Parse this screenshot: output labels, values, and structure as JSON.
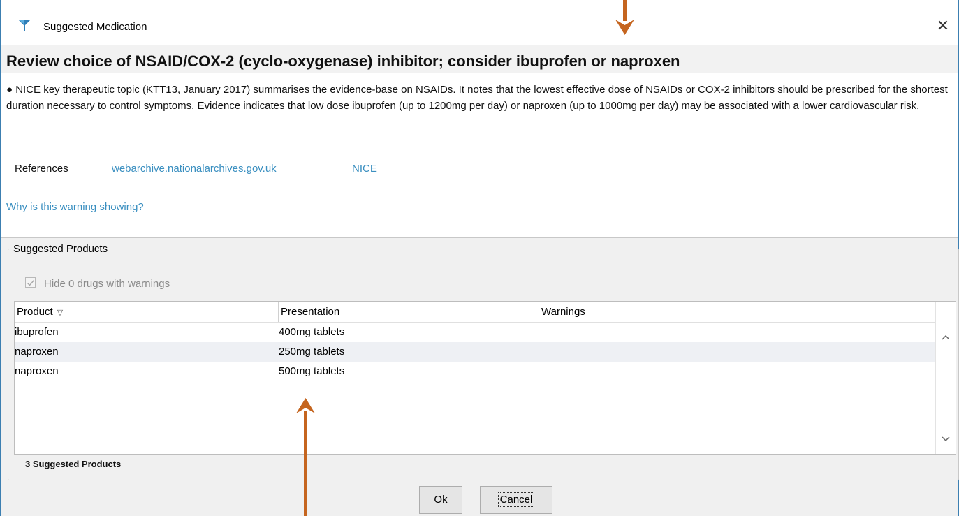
{
  "window": {
    "title": "Suggested Medication",
    "close_glyph": "✕",
    "icon": "funnel-app-icon"
  },
  "alert": {
    "heading": "Review choice of NSAID/COX-2 (cyclo-oxygenase) inhibitor; consider ibuprofen or naproxen",
    "body": "● NICE key therapeutic topic (KTT13, January 2017) summarises the evidence-base on NSAIDs. It notes that the lowest effective dose of NSAIDs or COX-2 inhibitors should be prescribed for the shortest duration necessary to control symptoms. Evidence indicates that low dose ibuprofen (up to 1200mg per day) or naproxen (up to 1000mg per day) may be associated with a lower cardiovascular risk.",
    "references_label": "References",
    "references": [
      "webarchive.nationalarchives.gov.uk",
      "NICE"
    ],
    "why_link": "Why is this warning showing?"
  },
  "suggested": {
    "group_label": "Suggested Products",
    "hide_checkbox_label": "Hide 0 drugs with warnings",
    "hide_checked": true,
    "columns": [
      "Product",
      "Presentation",
      "Warnings"
    ],
    "sort_icon": "▽",
    "rows": [
      {
        "product": "ibuprofen",
        "presentation": "400mg tablets",
        "warnings": ""
      },
      {
        "product": "naproxen",
        "presentation": "250mg tablets",
        "warnings": ""
      },
      {
        "product": "naproxen",
        "presentation": "500mg tablets",
        "warnings": ""
      }
    ],
    "count_text": "3 Suggested Products",
    "scroll_up": "⌃",
    "scroll_down": "⌄"
  },
  "buttons": {
    "ok": "Ok",
    "cancel": "Cancel"
  },
  "colors": {
    "accent_link": "#3a8fc0",
    "annotation_arrow": "#c5651f",
    "window_border": "#3c7fb1"
  }
}
